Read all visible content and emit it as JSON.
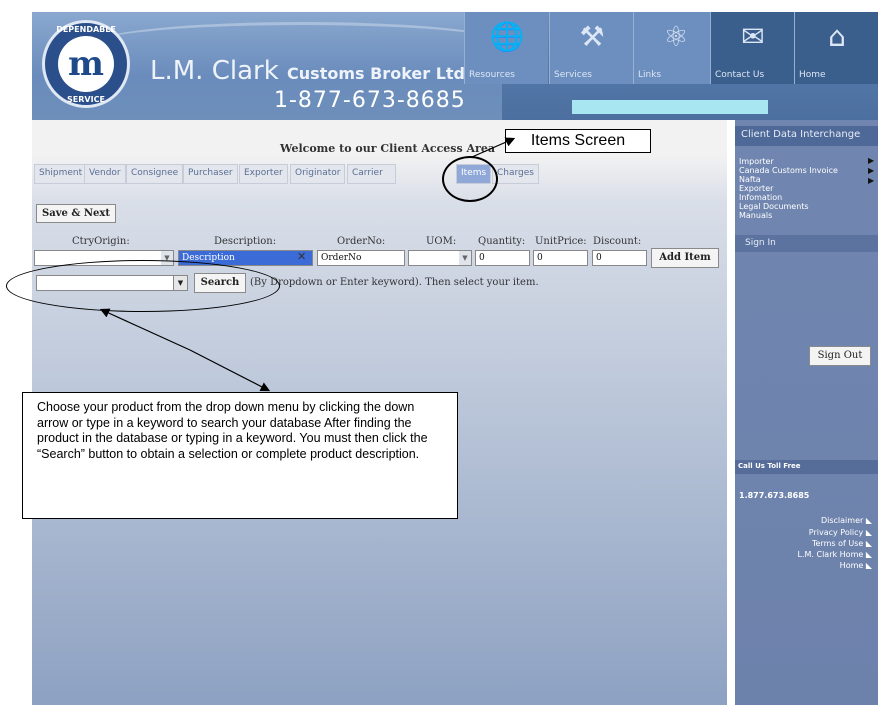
{
  "header": {
    "logo_top": "DEPENDABLE",
    "logo_bottom": "SERVICE",
    "logo_letter": "m",
    "brand": "L.M. Clark",
    "brand_suffix": "Customs Broker Ltd",
    "phone": "1-877-673-8685",
    "nav": [
      {
        "label": "Resources",
        "icon": "globe-icon",
        "glyph": "🌐"
      },
      {
        "label": "Services",
        "icon": "tools-icon",
        "glyph": "⚒"
      },
      {
        "label": "Links",
        "icon": "atom-icon",
        "glyph": "⚛"
      },
      {
        "label": "Contact Us",
        "icon": "mail-icon",
        "glyph": "✉"
      },
      {
        "label": "Home",
        "icon": "house-icon",
        "glyph": "⌂"
      }
    ]
  },
  "main": {
    "welcome": "Welcome to our Client Access Area",
    "tabs": [
      "Shipment",
      "Vendor",
      "Consignee",
      "Purchaser",
      "Exporter",
      "Originator",
      "Carrier",
      "Items",
      "Charges"
    ],
    "active_tab": "Items",
    "save_next": "Save & Next",
    "labels": {
      "ctry_origin": "CtryOrigin:",
      "description": "Description:",
      "order_no": "OrderNo:",
      "uom": "UOM:",
      "quantity": "Quantity:",
      "unit_price": "UnitPrice:",
      "discount": "Discount:"
    },
    "fields": {
      "ctry_origin": "",
      "description": "Description",
      "order_no": "OrderNo",
      "uom": "",
      "quantity": "0",
      "unit_price": "0",
      "discount": "0"
    },
    "add_item": "Add Item",
    "search_value": "",
    "search_button": "Search",
    "search_hint": "(By Dropdown or Enter keyword). Then select your item."
  },
  "annotations": {
    "items_label": "Items Screen",
    "callout": "Choose your product from the drop down menu by clicking the down arrow or type in a keyword to search your database After finding the product in the database or typing in a keyword. You must then click the “Search” button to obtain a selection or complete product description."
  },
  "sidebar": {
    "title": "Client Data Interchange",
    "links": [
      "Importer",
      "Canada Customs Invoice",
      "Nafta",
      "Exporter",
      "Infomation",
      "Legal Documents",
      "Manuals"
    ],
    "sign_in": "Sign In",
    "sign_out": "Sign Out",
    "toll_free_label": "Call Us Toll Free",
    "toll_free_number": "1.877.673.8685",
    "footer_links": [
      "Disclaimer",
      "Privacy Policy",
      "Terms of Use",
      "L.M. Clark Home",
      "Home"
    ]
  }
}
